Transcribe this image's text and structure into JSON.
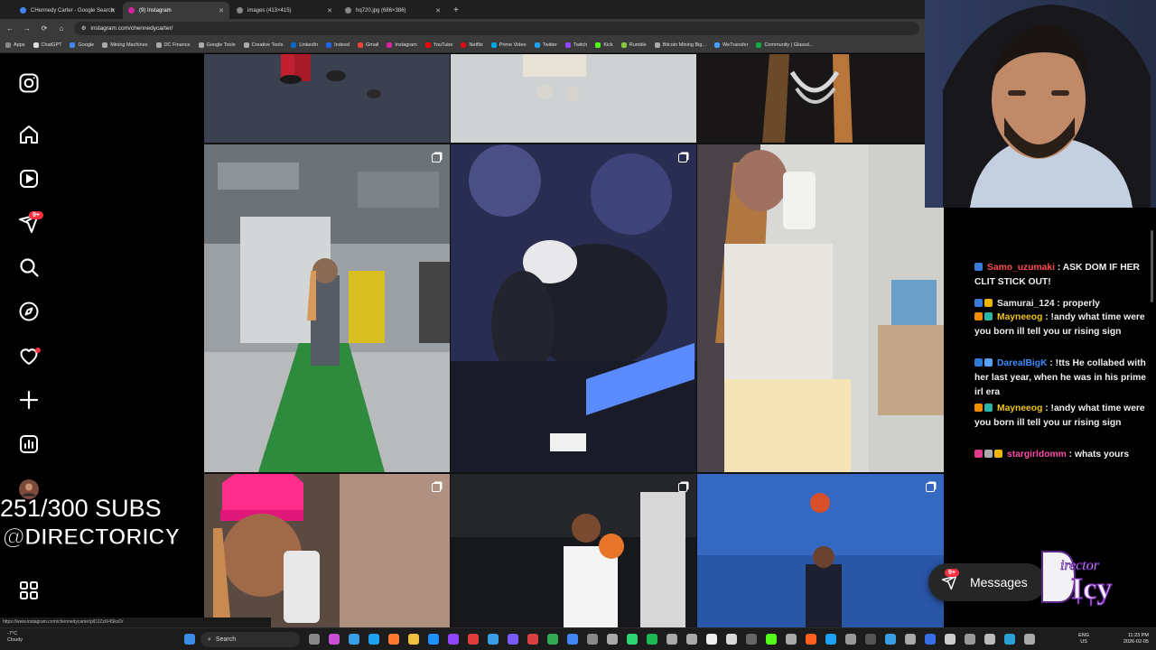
{
  "browser": {
    "tabs": [
      {
        "label": "CHennedy Carter - Google Search",
        "favicon_color": "#4285f4",
        "active": false
      },
      {
        "label": "(9) Instagram",
        "favicon_color": "#d6249f",
        "active": true
      },
      {
        "label": "images (413×415)",
        "favicon_color": "#888888",
        "active": false
      },
      {
        "label": "hq720.jpg (686×386)",
        "favicon_color": "#888888",
        "active": false
      }
    ],
    "url": "instagram.com/chennedycarter/",
    "bookmarks": [
      {
        "label": "Apps",
        "color": "#888888"
      },
      {
        "label": "ChatGPT",
        "color": "#dddddd"
      },
      {
        "label": "Google",
        "color": "#4285f4"
      },
      {
        "label": "Mining Machines",
        "color": "#aaaaaa"
      },
      {
        "label": "DC Finance",
        "color": "#aaaaaa"
      },
      {
        "label": "Google Tools",
        "color": "#aaaaaa"
      },
      {
        "label": "Creative Tools",
        "color": "#aaaaaa"
      },
      {
        "label": "LinkedIn",
        "color": "#0a66c2"
      },
      {
        "label": "Indeed",
        "color": "#2164f3"
      },
      {
        "label": "Gmail",
        "color": "#ea4335"
      },
      {
        "label": "Instagram",
        "color": "#d6249f"
      },
      {
        "label": "YouTube",
        "color": "#ff0000"
      },
      {
        "label": "Netflix",
        "color": "#e50914"
      },
      {
        "label": "Prime Video",
        "color": "#00a8e1"
      },
      {
        "label": "Twitter",
        "color": "#1da1f2"
      },
      {
        "label": "Twitch",
        "color": "#9146ff"
      },
      {
        "label": "Kick",
        "color": "#53fc18"
      },
      {
        "label": "Rumble",
        "color": "#85c742"
      },
      {
        "label": "Bitcoin Mining Big...",
        "color": "#aaaaaa"
      },
      {
        "label": "WeTransfer",
        "color": "#409fff"
      },
      {
        "label": "Community | Glassd...",
        "color": "#0caa41"
      }
    ]
  },
  "instagram": {
    "notifications_badge": "9+",
    "sidebar_icons": [
      "instagram-logo-icon",
      "home-icon",
      "reels-icon",
      "messages-icon",
      "search-icon",
      "explore-icon",
      "heart-icon",
      "create-icon",
      "dashboard-icon",
      "profile-avatar",
      "more-icon"
    ],
    "status_url": "https://www.instagram.com/chennedycarter/p/DJZzlX4SksD/",
    "messages": {
      "label": "Messages",
      "badge": "9+"
    }
  },
  "overlay": {
    "subs": "251/300 SUBS",
    "handle": "@DIRECTORICY"
  },
  "chat": [
    {
      "user": "Samo_uzumaki",
      "color": "#ff4d4d",
      "text": "ASK DOM IF HER CLIT STICK OUT!",
      "badge_colors": [
        "#3a7bd5"
      ]
    },
    {
      "user": "Samurai_124",
      "color": "#e8e8e8",
      "text": "properly",
      "badge_colors": [
        "#3a7bd5",
        "#f0b400"
      ]
    },
    {
      "user": "Mayneeog",
      "color": "#f0c419",
      "text": "!andy what time were you born ill tell you ur rising sign",
      "badge_colors": [
        "#f08c00",
        "#2bb5a8"
      ]
    },
    {
      "user": "DarealBigK",
      "color": "#3d8dff",
      "text": "!tts He collabed with her last year, when he was in his prime irl era",
      "badge_colors": [
        "#2b7bd5",
        "#5aa0ff"
      ]
    },
    {
      "user": "Mayneeog",
      "color": "#f0c419",
      "text": "!andy what time were you born ill tell you ur rising sign",
      "badge_colors": [
        "#f08c00",
        "#2bb5a8"
      ]
    },
    {
      "user": "stargirldomm",
      "color": "#ff4da6",
      "text": "whats yours",
      "badge_colors": [
        "#e03c8a",
        "#aaaaaa",
        "#f0b400"
      ]
    }
  ],
  "taskbar": {
    "weather_temp": "-7°C",
    "weather_desc": "Cloudy",
    "search_label": "Search",
    "lang_top": "ENG",
    "lang_bottom": "US",
    "time": "11:23 PM",
    "date": "2026-02-05"
  }
}
